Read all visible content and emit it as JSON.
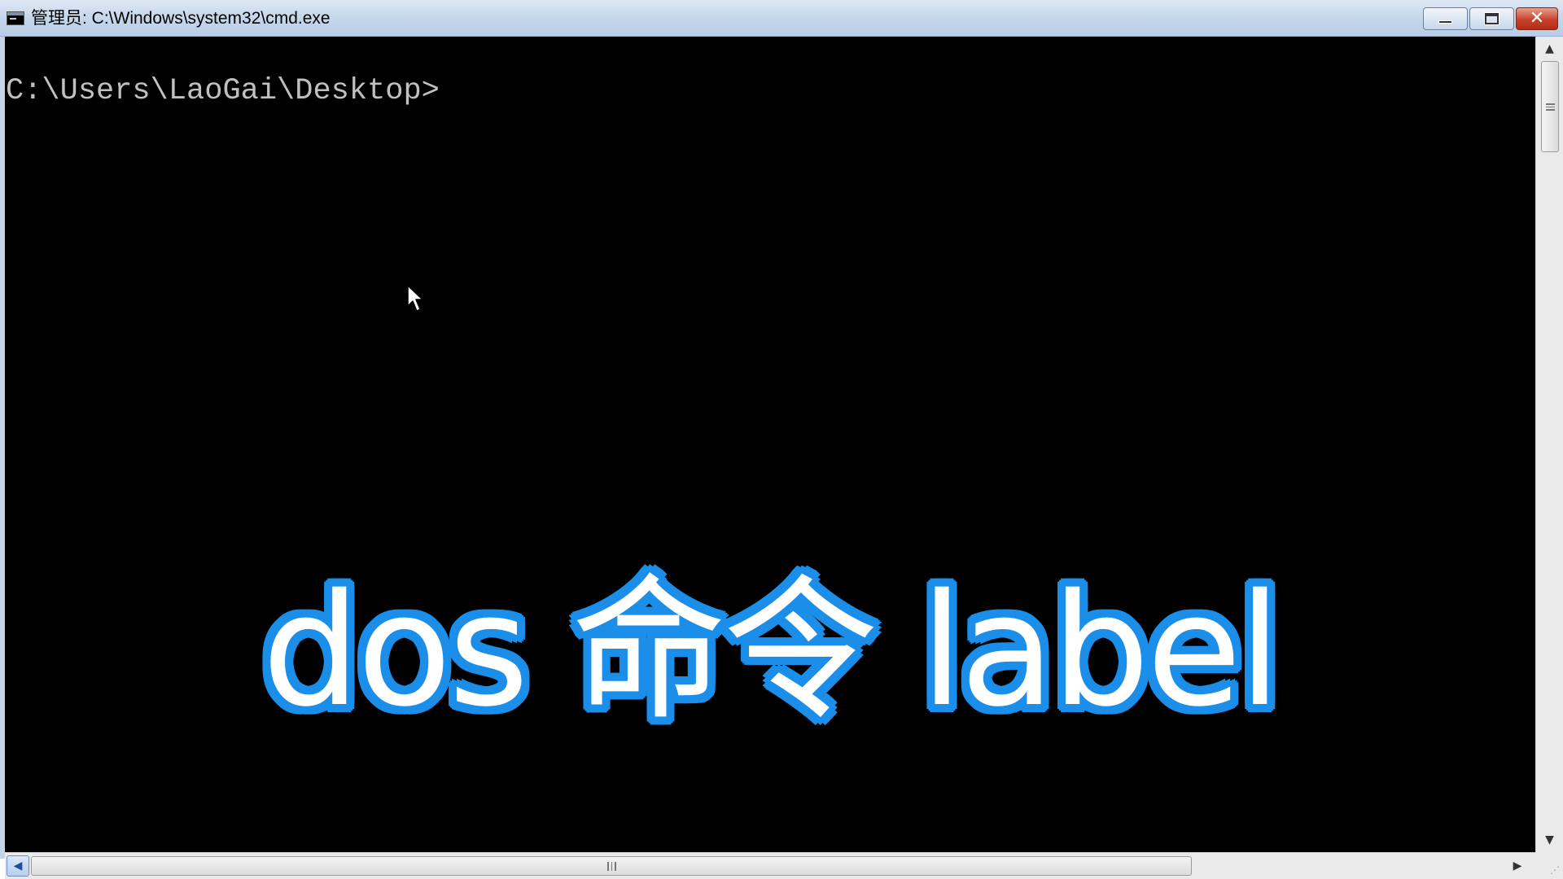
{
  "window": {
    "title": "管理员: C:\\Windows\\system32\\cmd.exe",
    "icon": "console-icon",
    "controls": {
      "minimize_icon": "minimize-icon",
      "maximize_icon": "maximize-icon",
      "close_glyph": "✕"
    }
  },
  "console": {
    "background": "#000000",
    "text_color": "#c0c0c0",
    "prompt": "C:\\Users\\LaoGai\\Desktop>"
  },
  "overlay": {
    "caption": "dos 命令 label",
    "fill_color": "#ffffff",
    "outline_color": "#1a8ee8"
  },
  "scrollbars": {
    "vertical": {
      "up_arrow": "▲",
      "down_arrow": "▼"
    },
    "horizontal": {
      "left_arrow": "◀",
      "right_arrow": "▶"
    }
  }
}
